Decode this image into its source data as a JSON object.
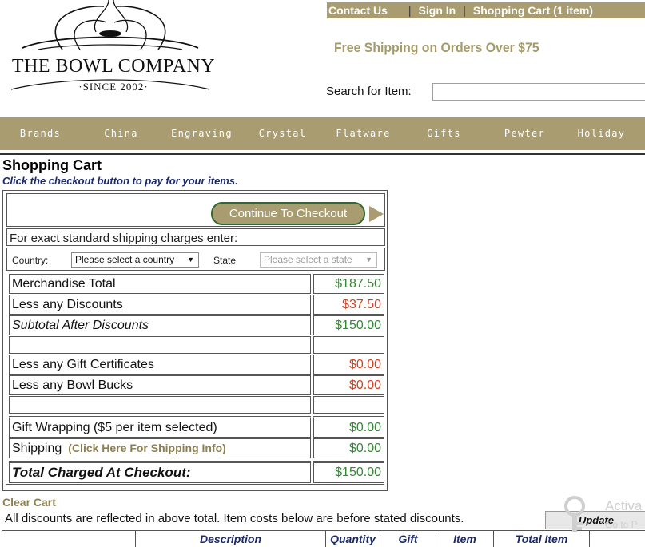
{
  "logo": {
    "name_line1": "THE BOWL COMPANY",
    "since": "·SINCE 2002·"
  },
  "top_links": {
    "contact": "Contact Us",
    "sep": "|",
    "signin": "Sign In",
    "cart": "Shopping Cart (1 item)"
  },
  "promo": "Free Shipping on Orders Over $75",
  "search": {
    "label": "Search for Item:",
    "value": "",
    "placeholder": ""
  },
  "nav": [
    "Brands",
    "China",
    "Engraving",
    "Crystal",
    "Flatware",
    "Gifts",
    "Pewter",
    "Holiday"
  ],
  "cart": {
    "title": "Shopping Cart",
    "subtitle": "Click the checkout button to pay for your items.",
    "checkout_label": "Continue To Checkout",
    "shipping_note": "For exact standard shipping charges enter:",
    "country_label": "Country:",
    "country_value": "Please select a country",
    "state_label": "State",
    "state_value": "Please select a state",
    "caret": "▼"
  },
  "totals": {
    "merch_label": "Merchandise Total",
    "merch_value": "$187.50",
    "discount_label": "Less any Discounts",
    "discount_value": "$37.50",
    "subtotal_label": "Subtotal After Discounts",
    "subtotal_value": "$150.00",
    "gift_cert_label": "Less any Gift Certificates",
    "gift_cert_value": "$0.00",
    "bowl_bucks_label": "Less any Bowl Bucks",
    "bowl_bucks_value": "$0.00",
    "gift_wrap_label": "Gift Wrapping ($5 per item selected)",
    "gift_wrap_value": "$0.00",
    "shipping_label": "Shipping",
    "shipping_link": "(Click Here For Shipping Info)",
    "shipping_value": "$0.00",
    "total_label": "Total Charged At Checkout:",
    "total_value": "$150.00"
  },
  "below": {
    "clear_cart": "Clear Cart",
    "discount_note": "All discounts are reflected in above total. Item costs below are before stated discounts.",
    "update_label": "Update",
    "columns": [
      "Description",
      "Quantity",
      "Gift",
      "Item",
      "Total Item"
    ]
  },
  "watermark": {
    "title": "Activa",
    "sub": "Go to P"
  },
  "colors": {
    "brand": "#a89c70",
    "link_gold": "#8c7f4e",
    "positive": "#2e8b2e",
    "negative": "#d3401f",
    "subtitle_blue": "#1a2a6c"
  }
}
